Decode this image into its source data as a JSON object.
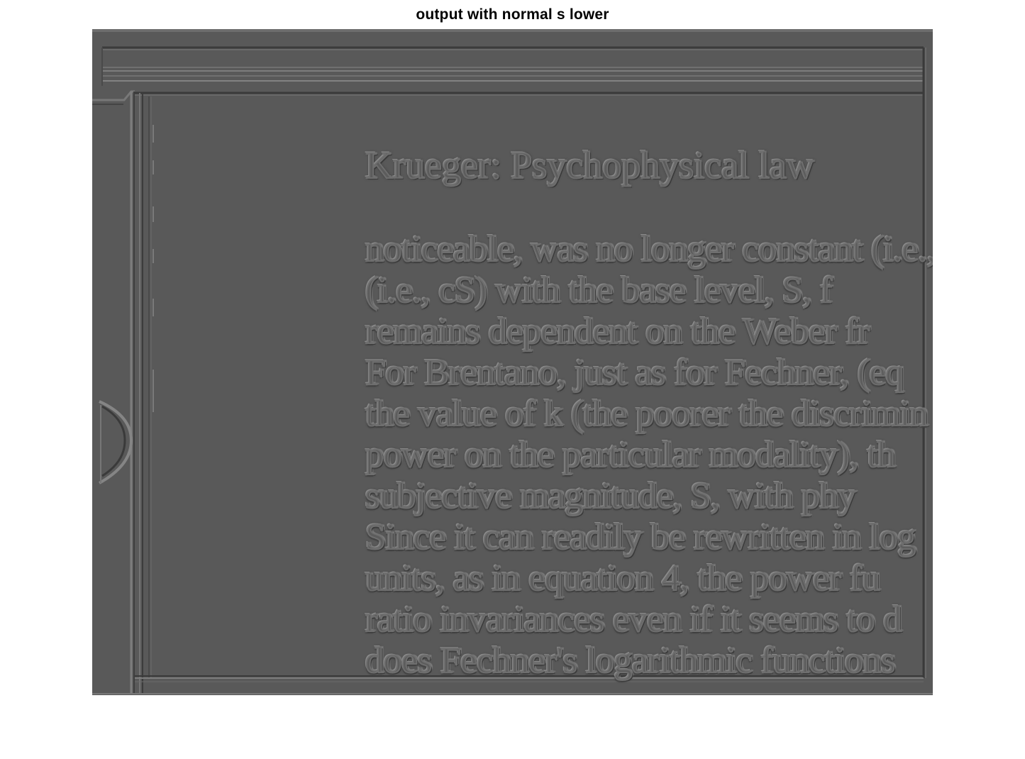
{
  "figure": {
    "title": "output with normal s lower"
  },
  "image": {
    "description_kind": "embossed filter output of a scanned book page",
    "background_color": "#5a5a5a",
    "heading": "Krueger: Psychophysical law",
    "lines": [
      "noticeable, was no longer constant (i.e.,",
      "(i.e., cS) with the base level, S, f",
      "remains dependent on the Weber fr",
      "For Brentano, just as for Fechner, (eq",
      "the value of k (the poorer the discrimin",
      "power on the particular modality), th",
      "subjective magnitude, S, with phy",
      "Since it can readily be rewritten in log",
      "units, as in equation 4, the power fu",
      "ratio invariances even if it seems to d",
      "does Fechner's logarithmic functions"
    ]
  }
}
